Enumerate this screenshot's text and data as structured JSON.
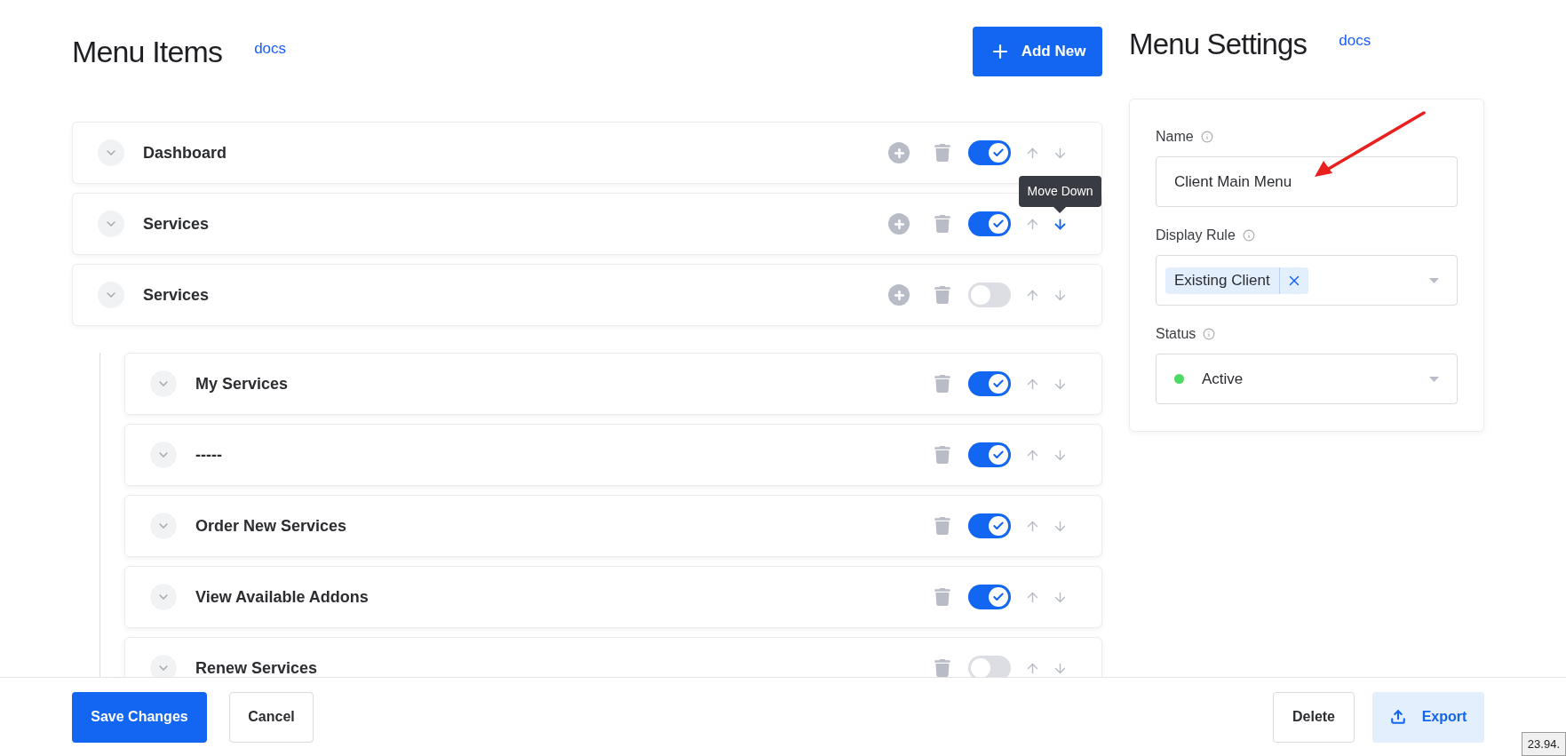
{
  "menu_items": {
    "title": "Menu Items",
    "docs_link": "docs",
    "add_button": "Add New",
    "items": [
      {
        "label": "Dashboard",
        "can_add_child": true,
        "enabled": true
      },
      {
        "label": "Services",
        "can_add_child": true,
        "enabled": true,
        "tooltip": "Move Down"
      },
      {
        "label": "Services",
        "can_add_child": true,
        "enabled": false,
        "children": [
          {
            "label": "My Services",
            "can_add_child": false,
            "enabled": true
          },
          {
            "label": "-----",
            "can_add_child": false,
            "enabled": true
          },
          {
            "label": "Order New Services",
            "can_add_child": false,
            "enabled": true
          },
          {
            "label": "View Available Addons",
            "can_add_child": false,
            "enabled": true
          },
          {
            "label": "Renew Services",
            "can_add_child": false,
            "enabled": false
          }
        ]
      }
    ]
  },
  "menu_settings": {
    "title": "Menu Settings",
    "docs_link": "docs",
    "name": {
      "label": "Name",
      "value": "Client Main Menu"
    },
    "display_rule": {
      "label": "Display Rule",
      "tags": [
        "Existing Client"
      ]
    },
    "status": {
      "label": "Status",
      "value": "Active",
      "color": "#4cd964"
    }
  },
  "footer": {
    "save_button": "Save Changes",
    "cancel_button": "Cancel",
    "delete_button": "Delete",
    "export_button": "Export"
  },
  "corner_badge": "23.94."
}
